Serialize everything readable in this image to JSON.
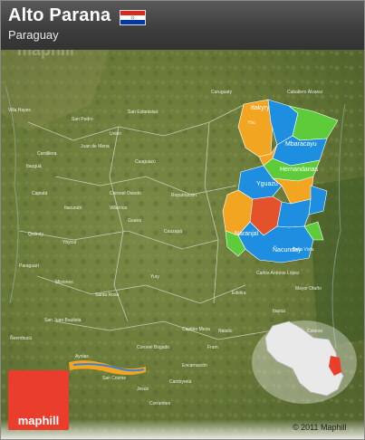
{
  "header": {
    "title": "Alto Parana",
    "subtitle": "Paraguay"
  },
  "watermark": "maphill",
  "colors": {
    "region_orange": "#f2a521",
    "region_blue": "#1e8fe0",
    "region_green": "#5ecb3a",
    "region_red": "#e3522a",
    "brand_red": "#ea3d2c"
  },
  "region_labels": [
    {
      "name": "Itakyry"
    },
    {
      "name": "Mbaracayu"
    },
    {
      "name": "Hernandarias"
    },
    {
      "name": "Yguazú"
    },
    {
      "name": "Naranjal"
    },
    {
      "name": "Ñacunday"
    }
  ],
  "place_labels": [
    "Curuguaty",
    "Villa Hayes",
    "San Estanislao",
    "Caaguazú",
    "Itauguá",
    "Cordillera",
    "Coronel Oviedo",
    "Repatriación",
    "Caazapá",
    "Guairá",
    "Villarrica",
    "Quiindy",
    "Ybycuí",
    "Paraguarí",
    "Misiones",
    "Yuty",
    "San Juan Bautista",
    "Carlos Antonio López",
    "Capitán Meza",
    "Encarnación",
    "Ñeembucú",
    "Itapúa",
    "Mayor Otaño",
    "Edelira",
    "Fram",
    "Natalio",
    "Cambyretá",
    "Ayolas",
    "Coronel Bogado",
    "Bella Vista",
    "San Cosme",
    "Jesús",
    "Corrientes",
    "Yhú",
    "Juan de Mena",
    "San Pedro",
    "Unión",
    "Capiatá",
    "Itacurubí",
    "Santa Rosa",
    "Caballero Álvarez",
    "Colonia"
  ],
  "footer": {
    "logo_text": "maphill",
    "copyright": "© 2011 Maphill"
  }
}
